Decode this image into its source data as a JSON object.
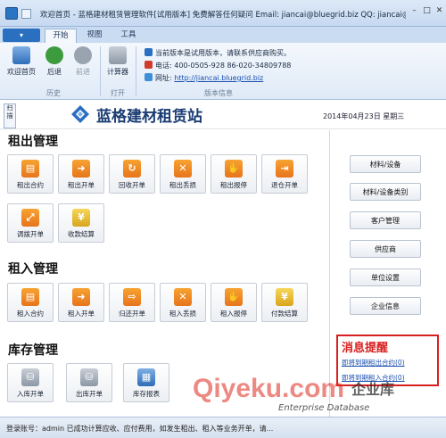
{
  "window": {
    "title": "欢迎首页 - 蓝格建材租赁管理软件[试用版本] 免费解答任何疑问 Email: jiancai@bluegrid.biz QQ: jiancai@..."
  },
  "ribbon": {
    "file_button": "▾",
    "tabs": [
      {
        "label": "开始"
      },
      {
        "label": "视图"
      },
      {
        "label": "工具"
      }
    ],
    "buttons": {
      "welcome": "欢迎首页",
      "back": "后退",
      "forward": "前进",
      "calculator": "计算器"
    },
    "groups": {
      "history": "历史",
      "open": "打开",
      "version": "版本信息"
    },
    "info": {
      "notice": "当前版本是试用版本，请联系供应商购买。",
      "phone": "电话:  400-0505-928  86-020-34809788",
      "website_label": "网址:",
      "website": "http://jiancai.bluegrid.biz"
    }
  },
  "header": {
    "side_tab": "扫描",
    "brand": "蓝格建材租赁站",
    "date": "2014年04月23日 星期三"
  },
  "sections": {
    "rent_out": {
      "title": "租出管理",
      "buttons": [
        "租出合约",
        "租出开单",
        "回收开单",
        "租出丢损",
        "租出报停",
        "退仓开单",
        "调拨开单",
        "收款结算"
      ]
    },
    "rent_in": {
      "title": "租入管理",
      "buttons": [
        "租入合约",
        "租入开单",
        "归还开单",
        "租入丢损",
        "租入报停",
        "付款结算"
      ]
    },
    "stock": {
      "title": "库存管理",
      "buttons": [
        "入库开单",
        "出库开单",
        "库存报表"
      ]
    }
  },
  "right_menu": [
    "材料/设备",
    "材料/设备类别",
    "客户管理",
    "供应商",
    "单位设置",
    "企业信息"
  ],
  "notice_panel": {
    "title": "消息提醒",
    "links": [
      "即将到期租出合约(0)",
      "即将到期租入合约(0)"
    ]
  },
  "status": {
    "text": "登录账号：admin    已成功计算应收、应付费用，如发生租出、租入等业务开单，请..."
  },
  "watermark": {
    "main": "Qiyeku.com",
    "cn": "企业库",
    "en": "Enterprise Database"
  },
  "colors": {
    "accent_blue": "#2a6fc0",
    "brand_navy": "#1a3d73",
    "notice_red": "#d81f1f",
    "icon_orange": "#e7741b"
  }
}
